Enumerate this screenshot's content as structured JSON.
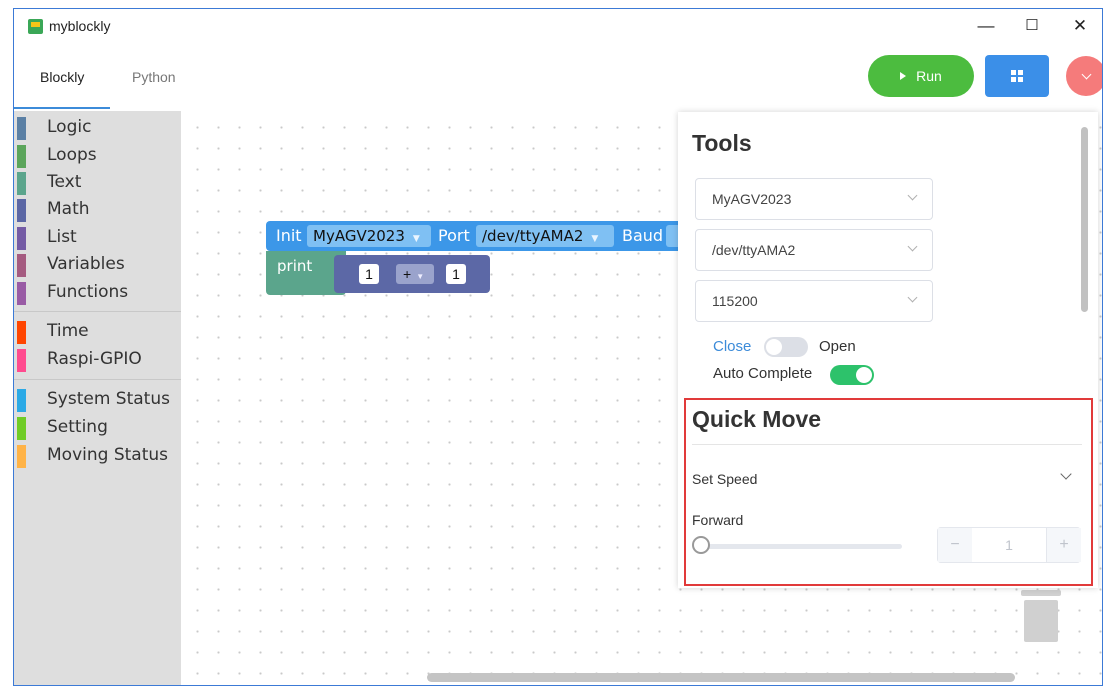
{
  "window": {
    "title": "myblockly",
    "controls": {
      "minimize": "—",
      "maximize": "☐",
      "close": "✕"
    }
  },
  "tabs": [
    {
      "label": "Blockly",
      "active": true
    },
    {
      "label": "Python",
      "active": false
    }
  ],
  "toolbar": {
    "run_label": "Run"
  },
  "sidebar": {
    "groups": [
      [
        {
          "label": "Logic",
          "color": "#5b80a5"
        },
        {
          "label": "Loops",
          "color": "#5ba55b"
        },
        {
          "label": "Text",
          "color": "#5ba58c"
        },
        {
          "label": "Math",
          "color": "#5b67a5"
        },
        {
          "label": "List",
          "color": "#745ba5"
        },
        {
          "label": "Variables",
          "color": "#a55b80"
        },
        {
          "label": "Functions",
          "color": "#995ba5"
        }
      ],
      [
        {
          "label": "Time",
          "color": "#ff4500"
        },
        {
          "label": "Raspi-GPIO",
          "color": "#ff4b8f"
        }
      ],
      [
        {
          "label": "System Status",
          "color": "#2ba9e6"
        },
        {
          "label": "Setting",
          "color": "#6fcc26"
        },
        {
          "label": "Moving Status",
          "color": "#ffb347"
        }
      ]
    ]
  },
  "blocks": {
    "init": {
      "label": "Init",
      "device": "MyAGV2023",
      "port_label": "Port",
      "port": "/dev/ttyAMA2",
      "baud_label": "Baud"
    },
    "print": {
      "label": "print",
      "left": "1",
      "op": "+",
      "right": "1"
    }
  },
  "tools": {
    "title": "Tools",
    "device_select": "MyAGV2023",
    "port_select": "/dev/ttyAMA2",
    "baud_select": "115200",
    "close_label": "Close",
    "open_label": "Open",
    "auto_complete_label": "Auto Complete",
    "accent": "#3c8bd9",
    "toggle_on_color": "#2dc26b"
  },
  "quick_move": {
    "title": "Quick Move",
    "set_speed_label": "Set Speed",
    "forward_label": "Forward",
    "stepper_value": "1",
    "minus": "−",
    "plus": "+",
    "highlight_color": "#e13a3a"
  }
}
